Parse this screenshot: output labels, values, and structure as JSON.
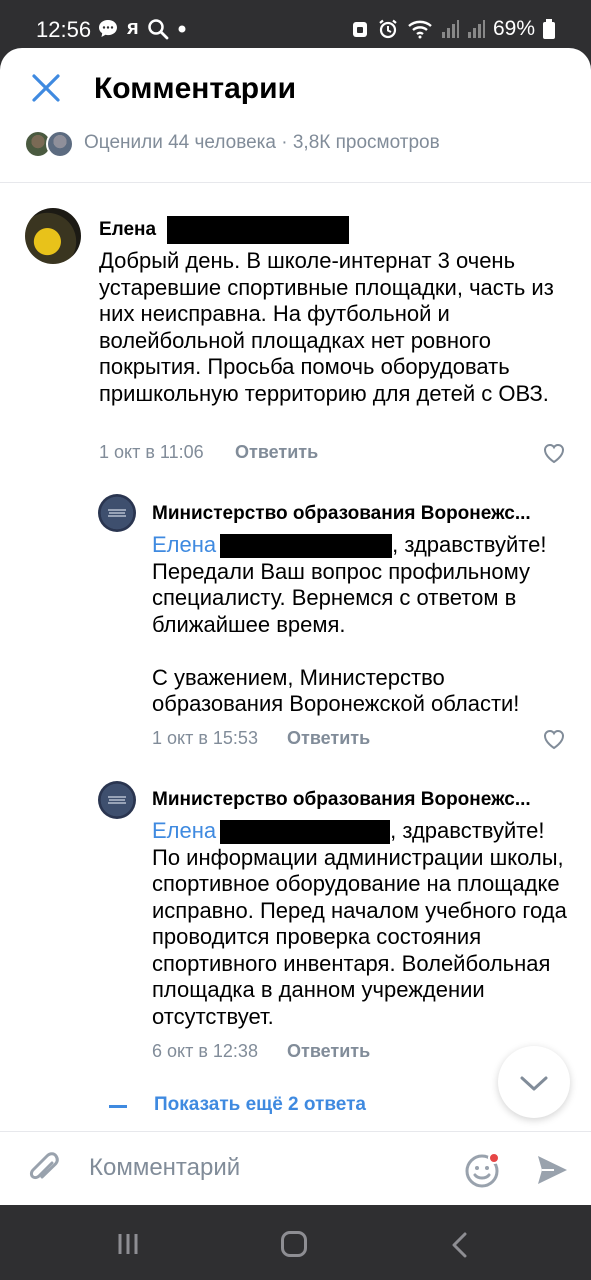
{
  "status_bar": {
    "time": "12:56",
    "left_icons": [
      "chat-icon",
      "yandex-icon",
      "search-icon",
      "dot-icon"
    ],
    "yandex_label": "я",
    "battery": "69%"
  },
  "header": {
    "title": "Комментарии",
    "likes_info": "Оценили 44 человека · 3,8К просмотров"
  },
  "comments": [
    {
      "author": "Елена",
      "text": "Добрый день. В школе-интернат 3 очень устаревшие спортивные площадки, часть из них неисправна. На футбольной и волейбольной площадках нет ровного покрытия. Просьба помочь оборудовать пришкольную территорию для детей с ОВЗ.",
      "date": "1 окт в 11:06",
      "reply_label": "Ответить"
    },
    {
      "author": "Министерство образования Воронежс...",
      "mention": "Елена",
      "text_after_mention": ", здравствуйте!",
      "text": "Передали Ваш вопрос профильному специалисту. Вернемся с ответом в ближайшее время.",
      "signature": "С уважением, Министерство образования Воронежской области!",
      "date": "1 окт в 15:53",
      "reply_label": "Ответить"
    },
    {
      "author": "Министерство образования Воронежс...",
      "mention": "Елена",
      "text_after_mention": ", здравствуйте!",
      "text": "По информации администрации школы, спортивное оборудование на площадке исправно. Перед началом учебного года проводится проверка состояния спортивного инвентаря. Волейбольная площадка в данном учреждении отсутствует.",
      "date": "6 окт в 12:38",
      "reply_label": "Ответить"
    }
  ],
  "show_more": "Показать ещё 2 ответа",
  "input": {
    "placeholder": "Комментарий"
  },
  "colors": {
    "accent": "#3f8ae0",
    "secondary_text": "#818c99",
    "background": "#ffffff",
    "system_bar": "#2f2f31"
  }
}
